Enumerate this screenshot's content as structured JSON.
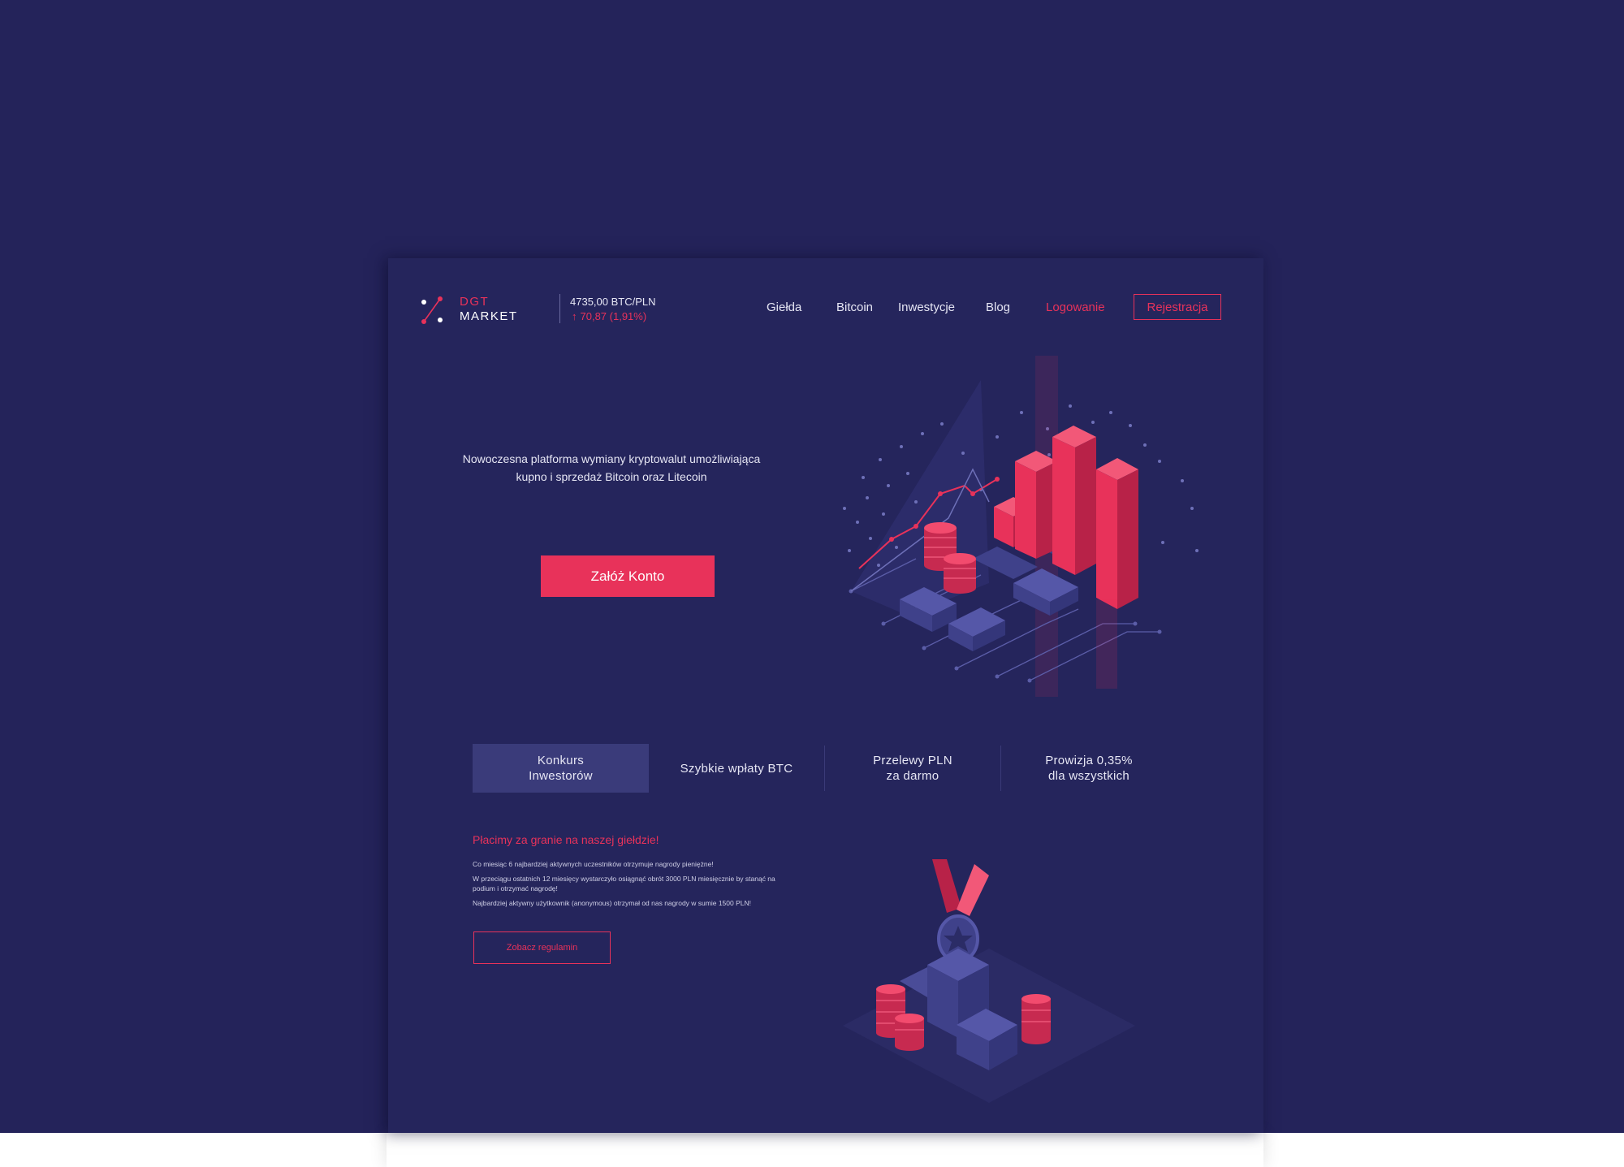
{
  "header": {
    "logo": {
      "line1": "DGT",
      "line2": "MARKET"
    },
    "ticker": {
      "price": "4735,00 BTC/PLN",
      "change": "70,87 (1,91%)"
    },
    "nav": [
      "Giełda",
      "Bitcoin",
      "Inwestycje",
      "Blog"
    ],
    "login_label": "Logowanie",
    "register_label": "Rejestracja"
  },
  "hero": {
    "tagline_line1": "Nowoczesna platforma wymiany kryptowalut umożliwiająca",
    "tagline_line2": "kupno i sprzedaż Bitcoin oraz Litecoin",
    "cta_label": "Załóż Konto"
  },
  "tabs": [
    {
      "line1": "Konkurs",
      "line2": "Inwestorów",
      "active": true
    },
    {
      "line1": "Szybkie wpłaty BTC",
      "line2": "",
      "active": false
    },
    {
      "line1": "Przelewy PLN",
      "line2": "za darmo",
      "active": false
    },
    {
      "line1": "Prowizja 0,35%",
      "line2": "dla wszystkich",
      "active": false
    }
  ],
  "contest": {
    "title": "Płacimy za granie na naszej giełdzie!",
    "p1": "Co miesiąc 6 najbardziej aktywnych uczestników otrzymuje nagrody pieniężne!",
    "p2": "W przeciągu ostatnich 12 miesięcy wystarczyło osiągnąć obrót 3000 PLN miesięcznie by stanąć na podium i otrzymać nagrodę!",
    "p3": "Najbardziej aktywny użytkownik (anonymous) otrzymał od nas nagrody w sumie 1500 PLN!",
    "button_label": "Zobacz regulamin"
  },
  "colors": {
    "background": "#24235a",
    "accent": "#e8325a",
    "tab_active": "#3a3b7a"
  },
  "icons": [
    "logo-mark-icon",
    "arrow-up-icon",
    "isometric-chart-illustration",
    "medal-podium-illustration"
  ]
}
